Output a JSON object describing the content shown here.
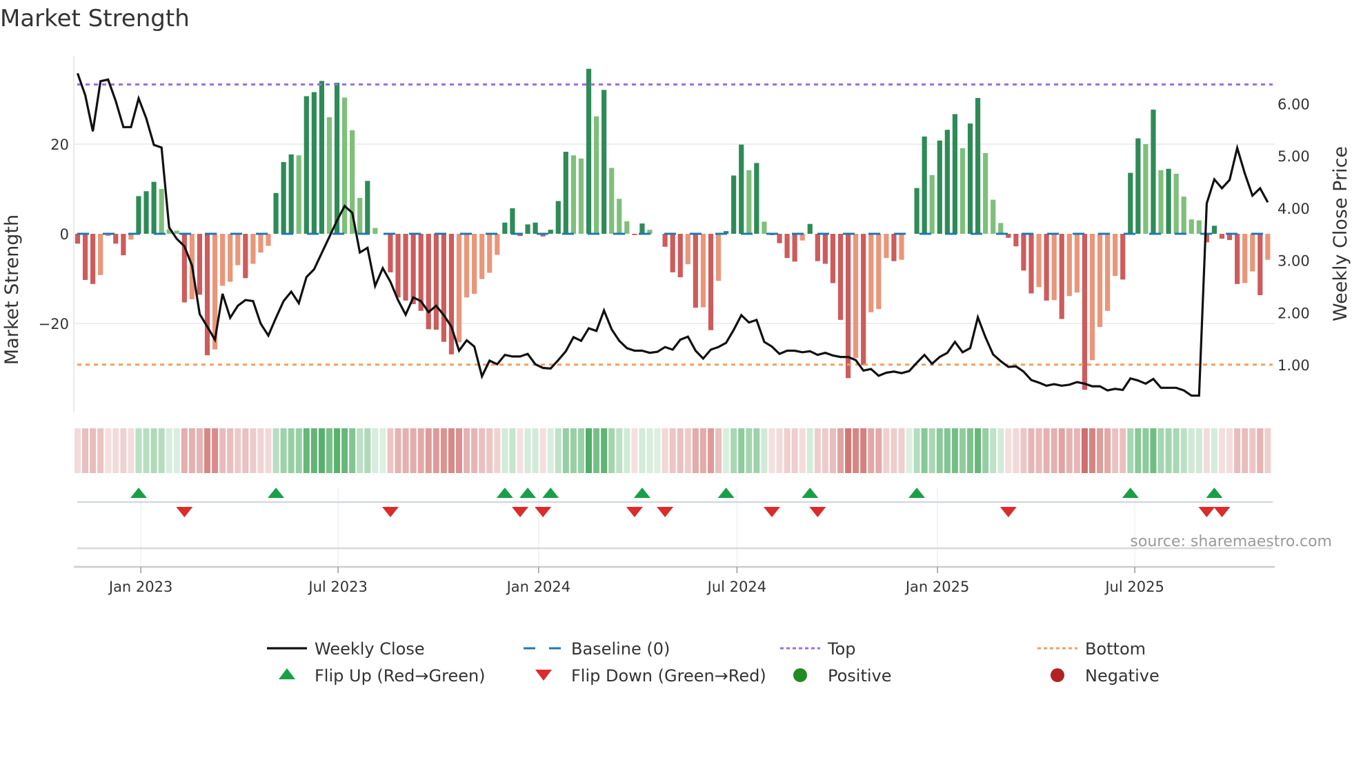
{
  "title": "Market Strength",
  "source": "source: sharemaestro.com",
  "chart_data": {
    "type": "bar",
    "title": "Market Strength",
    "ylabel": "Market Strength",
    "y2label": "Weekly Close Price",
    "ylim": [
      -40,
      40
    ],
    "y2lim": [
      0.1,
      6.9
    ],
    "grid": true,
    "legend_placement": "bottom",
    "x_start": "2022-11-04",
    "x_step_days": 7,
    "left_ticks": [
      {
        "v": 20,
        "label": "20"
      },
      {
        "v": 0,
        "label": "0"
      },
      {
        "v": -20,
        "label": "−20"
      }
    ],
    "right_ticks": [
      {
        "v": 1,
        "label": "1.00"
      },
      {
        "v": 2,
        "label": "2.00"
      },
      {
        "v": 3,
        "label": "3.00"
      },
      {
        "v": 4,
        "label": "4.00"
      },
      {
        "v": 5,
        "label": "5.00"
      },
      {
        "v": 6,
        "label": "6.00"
      }
    ],
    "x_ticks": [
      {
        "date": "2023-01-01",
        "label": "Jan 2023"
      },
      {
        "date": "2023-07-01",
        "label": "Jul 2023"
      },
      {
        "date": "2024-01-01",
        "label": "Jan 2024"
      },
      {
        "date": "2024-07-01",
        "label": "Jul 2024"
      },
      {
        "date": "2025-01-01",
        "label": "Jan 2025"
      },
      {
        "date": "2025-07-01",
        "label": "Jul 2025"
      }
    ],
    "top_level": 33.3,
    "bottom_level": -29.2,
    "strength": [
      -2.2,
      -10.3,
      -11.2,
      -9.2,
      -0.5,
      -2.2,
      -4.8,
      -1.3,
      8.4,
      9.5,
      11.6,
      10,
      1,
      0.7,
      -15.3,
      -14.6,
      -13.6,
      -27.1,
      -25.8,
      -11.6,
      -10.7,
      -7,
      -9.9,
      -6.7,
      -4.2,
      -2.7,
      9.1,
      16,
      17.7,
      17.5,
      30.7,
      31.6,
      34.1,
      26,
      33.7,
      30.4,
      23.1,
      8,
      11.8,
      1.3,
      0,
      -8.6,
      -14.2,
      -14.9,
      -15.7,
      -17.2,
      -21.3,
      -21.4,
      -24.1,
      -26.9,
      -24.2,
      -14.2,
      -13.4,
      -10.1,
      -8.7,
      -4.7,
      2.5,
      5.7,
      -0.5,
      2.1,
      2.5,
      -0.6,
      0.9,
      7.3,
      18.3,
      17.5,
      16.8,
      36.8,
      26.2,
      32.1,
      14.7,
      7.8,
      2.8,
      -0.3,
      2.3,
      0.9,
      0,
      -2.9,
      -8.6,
      -9.7,
      -6.8,
      -16.5,
      -16.4,
      -21.5,
      -10.5,
      0.6,
      13,
      19.9,
      14.2,
      15.8,
      2.7,
      -0.3,
      -2.1,
      -5.4,
      -6.2,
      -1.5,
      2.2,
      -6.1,
      -6.7,
      -11,
      -19.2,
      -32.2,
      -27.7,
      -29.3,
      -17.5,
      -16.8,
      -5.4,
      -6.1,
      -5.8,
      0,
      10.2,
      21.7,
      13.1,
      20.8,
      23.2,
      26.7,
      19.1,
      24.6,
      30.3,
      18,
      7.6,
      2.4,
      -0.9,
      -2.8,
      -8.2,
      -13.3,
      -11.9,
      -14.9,
      -14.8,
      -19,
      -13.9,
      -13.1,
      -34.8,
      -28.2,
      -20.8,
      -17.2,
      -9.4,
      -10.2,
      13.6,
      21.3,
      20,
      27.7,
      14.2,
      14.5,
      13.4,
      8.3,
      3.2,
      3,
      -1.9,
      1.8,
      -1.1,
      -1.4,
      -11.2,
      -11,
      -8.4,
      -13.7,
      -5.8
    ],
    "tone": "DDDLLDDLDDDLLLDLDDLLLLDLLLDDDLDDDLDLLLDLLDDDDDDDDDLLLLLLDDDDDDDDDLLDLDLLLDDLLDDDLDLDLDDDLDLDDDDLDDDDDDLDLLLDLLDDLDDDLDDLLLDDDDLDLDLLDLLLLDDDLDLDLLLLDDDDDLLDL",
    "weekly_close": [
      6.58,
      6.16,
      5.47,
      6.43,
      6.46,
      6.05,
      5.55,
      5.55,
      6.1,
      5.72,
      5.21,
      5.16,
      3.63,
      3.41,
      3.27,
      2.9,
      1.97,
      1.73,
      1.48,
      2.36,
      1.9,
      2.13,
      2.24,
      2.22,
      1.79,
      1.56,
      1.9,
      2.22,
      2.4,
      2.18,
      2.68,
      2.83,
      3.14,
      3.45,
      3.76,
      4.04,
      3.91,
      3.15,
      3.24,
      2.51,
      2.85,
      2.59,
      2.24,
      1.96,
      2.29,
      2.22,
      2.01,
      2.13,
      1.95,
      1.73,
      1.27,
      1.47,
      1.35,
      0.78,
      1.08,
      1.01,
      1.19,
      1.16,
      1.16,
      1.21,
      1.01,
      0.94,
      0.93,
      1.09,
      1.26,
      1.53,
      1.46,
      1.7,
      1.65,
      2.04,
      1.68,
      1.46,
      1.32,
      1.27,
      1.27,
      1.23,
      1.25,
      1.34,
      1.29,
      1.48,
      1.54,
      1.27,
      1.12,
      1.29,
      1.34,
      1.42,
      1.67,
      1.95,
      1.81,
      1.86,
      1.44,
      1.35,
      1.21,
      1.27,
      1.27,
      1.24,
      1.26,
      1.19,
      1.23,
      1.18,
      1.15,
      1.15,
      1.09,
      0.89,
      0.92,
      0.79,
      0.85,
      0.87,
      0.84,
      0.88,
      1.04,
      1.19,
      1.02,
      1.15,
      1.23,
      1.44,
      1.24,
      1.32,
      1.91,
      1.53,
      1.2,
      1.07,
      0.96,
      0.97,
      0.87,
      0.71,
      0.66,
      0.6,
      0.63,
      0.6,
      0.62,
      0.67,
      0.64,
      0.59,
      0.59,
      0.51,
      0.54,
      0.52,
      0.74,
      0.7,
      0.64,
      0.73,
      0.56,
      0.56,
      0.56,
      0.51,
      0.41,
      0.41,
      4.09,
      4.55,
      4.38,
      4.54,
      5.15,
      4.66,
      4.24,
      4.38,
      4.11
    ],
    "flip_up_weeks": [
      9,
      27,
      57,
      60,
      63,
      75,
      86,
      97,
      111,
      139,
      150
    ],
    "flip_down_weeks": [
      15,
      42,
      59,
      62,
      74,
      78,
      92,
      98,
      123,
      149,
      151
    ],
    "legend": [
      {
        "key": "weekly_close",
        "label": "Weekly Close"
      },
      {
        "key": "baseline",
        "label": "Baseline (0)"
      },
      {
        "key": "top",
        "label": "Top"
      },
      {
        "key": "bottom",
        "label": "Bottom"
      },
      {
        "key": "flip_up",
        "label": "Flip Up (Red→Green)"
      },
      {
        "key": "flip_down",
        "label": "Flip Down (Green→Red)"
      },
      {
        "key": "positive",
        "label": "Positive"
      },
      {
        "key": "negative",
        "label": "Negative"
      }
    ]
  },
  "colors": {
    "pos_strong": "#2e8b57",
    "pos_weak": "#7fbf7b",
    "neg_strong": "#cd5c5c",
    "neg_weak": "#e9967a",
    "line": "#111111",
    "baseline": "#1f77b4",
    "top": "#9b6fdc",
    "bottom": "#f0a060",
    "flip_up": "#18a048",
    "flip_down": "#dd2a2a",
    "positive": "#228b22",
    "negative": "#b22222"
  }
}
